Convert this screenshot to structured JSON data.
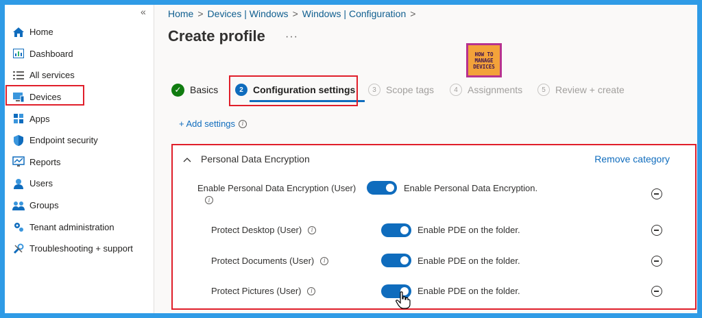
{
  "sidebar": {
    "collapse_icon": "«",
    "items": [
      {
        "label": "Home",
        "icon": "home-icon"
      },
      {
        "label": "Dashboard",
        "icon": "dashboard-icon"
      },
      {
        "label": "All services",
        "icon": "list-icon"
      },
      {
        "label": "Devices",
        "icon": "devices-icon"
      },
      {
        "label": "Apps",
        "icon": "apps-icon"
      },
      {
        "label": "Endpoint security",
        "icon": "shield-icon"
      },
      {
        "label": "Reports",
        "icon": "reports-icon"
      },
      {
        "label": "Users",
        "icon": "user-icon"
      },
      {
        "label": "Groups",
        "icon": "groups-icon"
      },
      {
        "label": "Tenant administration",
        "icon": "tenant-icon"
      },
      {
        "label": "Troubleshooting + support",
        "icon": "wrench-icon"
      }
    ]
  },
  "breadcrumb": [
    "Home",
    "Devices | Windows",
    "Windows | Configuration"
  ],
  "breadcrumb_sep": ">",
  "page": {
    "title": "Create profile",
    "more": "···"
  },
  "logo": {
    "line1": "HOW TO",
    "line2": "MANAGE",
    "line3": "DEVICES"
  },
  "steps": [
    {
      "num": "✓",
      "label": "Basics",
      "state": "done"
    },
    {
      "num": "2",
      "label": "Configuration settings",
      "state": "current"
    },
    {
      "num": "3",
      "label": "Scope tags",
      "state": "pending"
    },
    {
      "num": "4",
      "label": "Assignments",
      "state": "pending"
    },
    {
      "num": "5",
      "label": "Review + create",
      "state": "pending"
    }
  ],
  "add_settings": "+ Add settings",
  "category": {
    "title": "Personal Data Encryption",
    "remove": "Remove category",
    "settings": [
      {
        "label": "Enable Personal Data Encryption (User)",
        "value": "Enable Personal Data Encryption.",
        "enabled": true
      },
      {
        "label": "Protect Desktop (User)",
        "value": "Enable PDE on the folder.",
        "enabled": true
      },
      {
        "label": "Protect Documents (User)",
        "value": "Enable PDE on the folder.",
        "enabled": true
      },
      {
        "label": "Protect Pictures (User)",
        "value": "Enable PDE on the folder.",
        "enabled": true
      }
    ]
  },
  "colors": {
    "accent": "#0f6cbd",
    "highlight": "#e01e2a",
    "success": "#107c10"
  }
}
